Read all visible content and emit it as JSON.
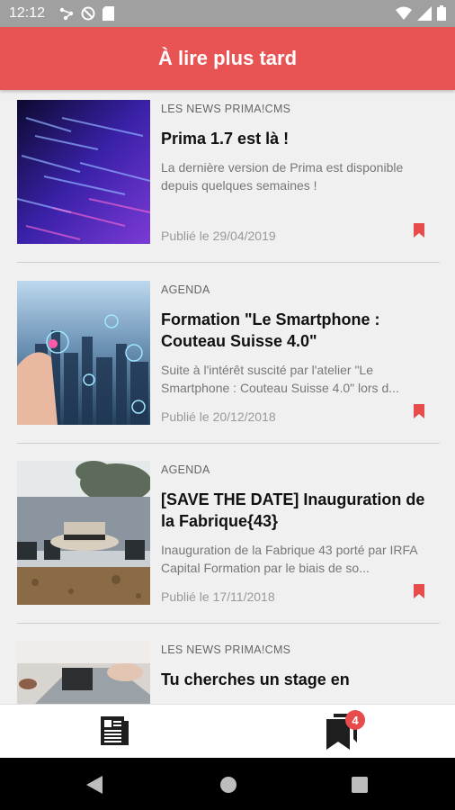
{
  "status": {
    "time": "12:12"
  },
  "header": {
    "title": "À lire plus tard"
  },
  "articles": [
    {
      "category": "LES NEWS PRIMA!CMS",
      "title": "Prima 1.7 est là !",
      "excerpt": "La dernière version de Prima est disponible depuis quelques semaines !",
      "date": "Publié le 29/04/2019"
    },
    {
      "category": "AGENDA",
      "title": "Formation \"Le Smartphone : Couteau Suisse 4.0\"",
      "excerpt": "Suite à l'intérêt suscité par l'atelier \"Le Smartphone : Couteau Suisse 4.0\" lors d...",
      "date": "Publié le 20/12/2018"
    },
    {
      "category": "AGENDA",
      "title": "[SAVE THE DATE] Inauguration de la Fabrique{43}",
      "excerpt": "Inauguration de la Fabrique 43 porté par IRFA Capital Formation par le biais de so...",
      "date": "Publié le 17/11/2018"
    },
    {
      "category": "LES NEWS PRIMA!CMS",
      "title": "Tu cherches un stage en"
    }
  ],
  "bottom_nav": {
    "saved_badge": "4"
  },
  "colors": {
    "brand": "#e85454",
    "bookmark": "#e84b4b"
  }
}
